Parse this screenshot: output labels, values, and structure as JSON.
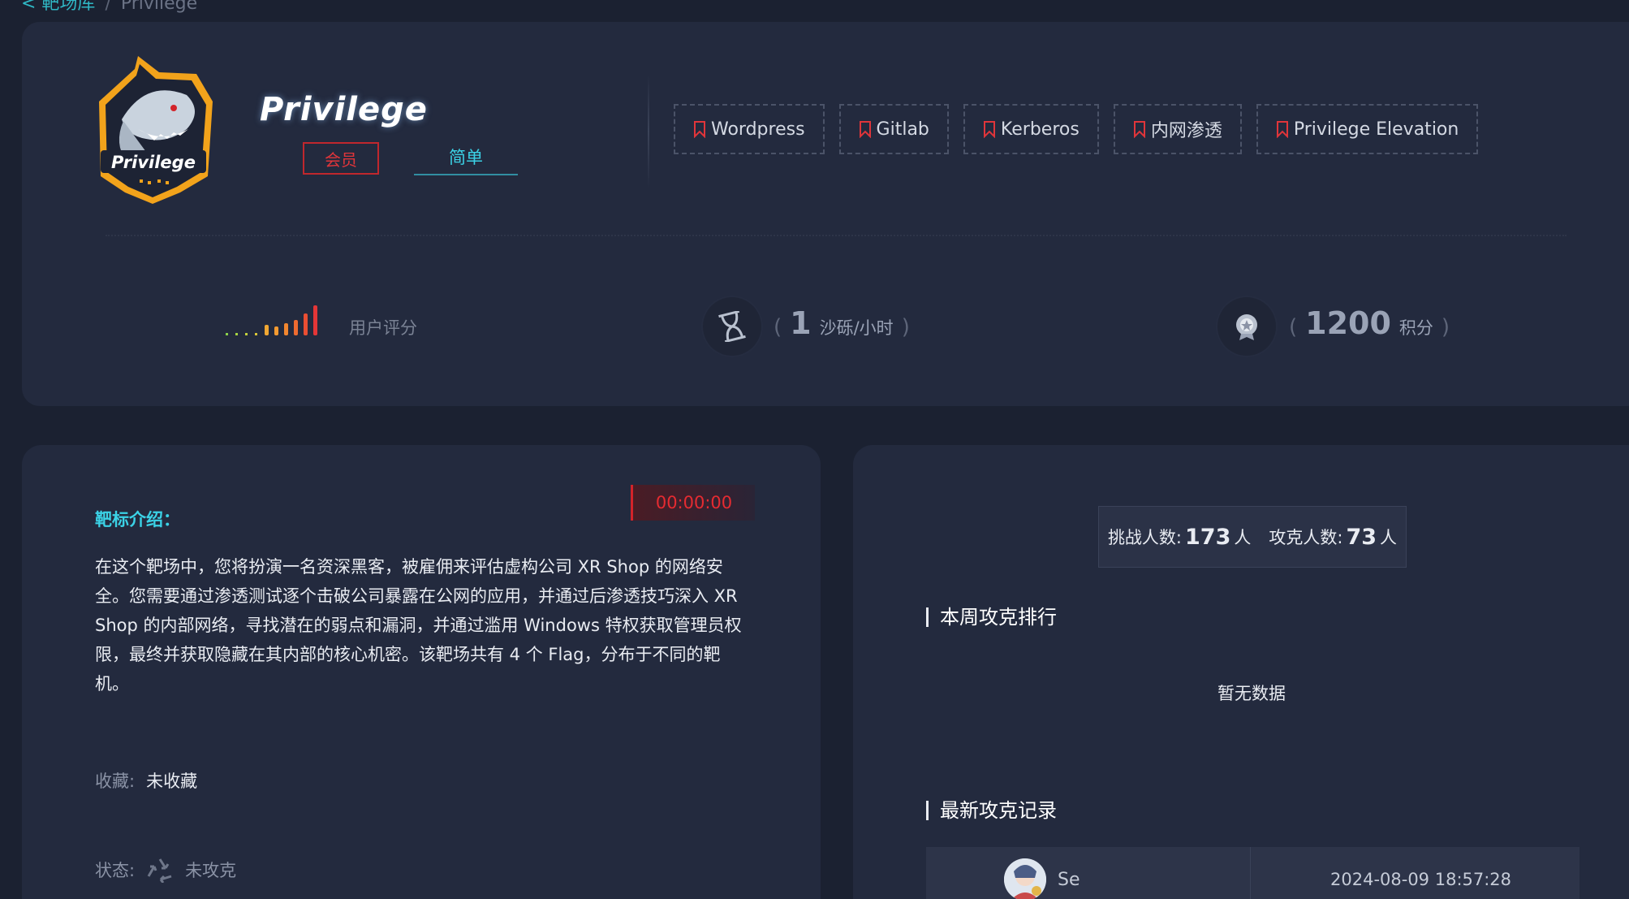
{
  "breadcrumb": {
    "back_label": "< 靶场库",
    "separator": "/",
    "current": "Privilege"
  },
  "machine": {
    "title": "Privilege",
    "logo_text": "Privilege",
    "member_badge": "会员",
    "difficulty": "简单",
    "tags": [
      "Wordpress",
      "Gitlab",
      "Kerberos",
      "内网渗透",
      "Privilege Elevation"
    ]
  },
  "stats": {
    "rating_label": "用户评分",
    "rating_level": 0.6,
    "sand_rate": {
      "value": "1",
      "unit": "沙砾/小时"
    },
    "points": {
      "value": "1200",
      "unit": "积分"
    },
    "paren_open": "(",
    "paren_close": ")"
  },
  "intro": {
    "label": "靶标介绍：",
    "timer": "00:00:00",
    "text": "在这个靶场中，您将扮演一名资深黑客，被雇佣来评估虚构公司 XR Shop 的网络安全。您需要通过渗透测试逐个击破公司暴露在公网的应用，并通过后渗透技巧深入 XR Shop 的内部网络，寻找潜在的弱点和漏洞，并通过滥用 Windows 特权获取管理员权限，最终并获取隐藏在其内部的核心机密。该靶场共有 4 个 Flag，分布于不同的靶机。",
    "favorite_label": "收藏:",
    "favorite_value": "未收藏",
    "status_label": "状态:",
    "status_value": "未攻克"
  },
  "leaderboard": {
    "challengers_label": "挑战人数:",
    "challengers_count": "173",
    "challengers_unit": "人",
    "solved_label": "攻克人数:",
    "solved_count": "73",
    "solved_unit": "人",
    "weekly_title": "本周攻克排行",
    "no_data": "暂无数据",
    "latest_title": "最新攻克记录",
    "records": [
      {
        "name": "Se",
        "time": "2024-08-09 18:57:28"
      }
    ]
  },
  "colors": {
    "accent_cyan": "#3bd2e6",
    "accent_red": "#e0353a",
    "background": "#1b2131",
    "card": "#232a3e"
  }
}
